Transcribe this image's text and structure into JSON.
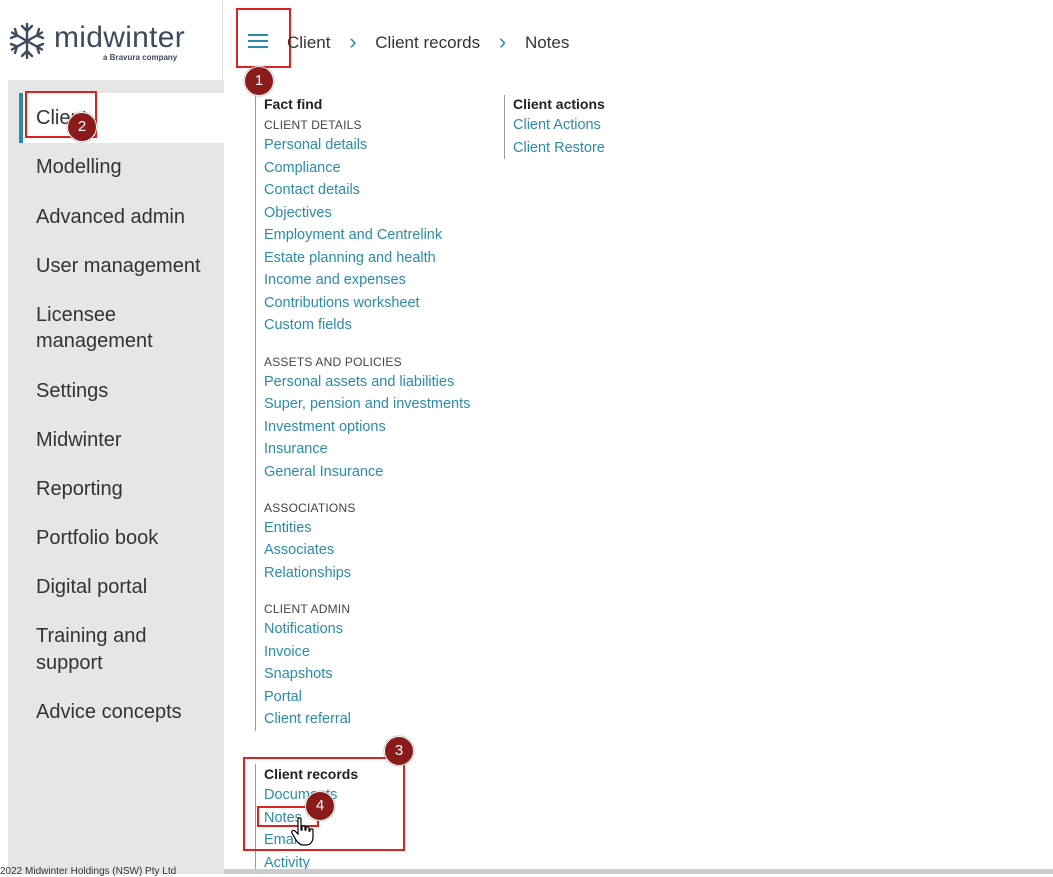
{
  "app": {
    "logo_text": "midwinter",
    "logo_sub": "a Bravura company"
  },
  "breadcrumb": [
    "Client",
    "Client records",
    "Notes"
  ],
  "sidebar": {
    "items": [
      {
        "label": "Client"
      },
      {
        "label": "Modelling"
      },
      {
        "label": "Advanced admin"
      },
      {
        "label": "User management"
      },
      {
        "label": "Licensee"
      },
      {
        "label": "management"
      },
      {
        "label": "Settings"
      },
      {
        "label": "Midwinter"
      },
      {
        "label": "Reporting"
      },
      {
        "label": "Portfolio book"
      },
      {
        "label": "Digital portal"
      },
      {
        "label": "Training and"
      },
      {
        "label": "support"
      },
      {
        "label": "Advice concepts"
      }
    ],
    "footer": "2022 Midwinter Holdings (NSW) Pty Ltd"
  },
  "menu": {
    "fact_find": {
      "title": "Fact find",
      "client_details": {
        "heading": "CLIENT DETAILS",
        "links": [
          "Personal details",
          "Compliance",
          "Contact details",
          "Objectives",
          "Employment and Centrelink",
          "Estate planning and health",
          "Income and expenses",
          "Contributions worksheet",
          "Custom fields"
        ]
      },
      "assets_policies": {
        "heading": "ASSETS AND POLICIES",
        "links": [
          "Personal assets and liabilities",
          "Super, pension and investments",
          "Investment options",
          "Insurance",
          "General Insurance"
        ]
      },
      "associations": {
        "heading": "ASSOCIATIONS",
        "links": [
          "Entities",
          "Associates",
          "Relationships"
        ]
      },
      "client_admin": {
        "heading": "CLIENT ADMIN",
        "links": [
          "Notifications",
          "Invoice",
          "Snapshots",
          "Portal",
          "Client referral"
        ]
      }
    },
    "client_actions": {
      "title": "Client actions",
      "links": [
        "Client Actions",
        "Client Restore"
      ]
    },
    "client_records": {
      "title": "Client records",
      "links": [
        "Documents",
        "Notes",
        "Emails",
        "Activity"
      ]
    }
  },
  "annotations": [
    "1",
    "2",
    "3",
    "4"
  ],
  "colors": {
    "accent": "#2a8ca8",
    "highlight": "#dd2222",
    "badge": "#8b1a1a"
  }
}
